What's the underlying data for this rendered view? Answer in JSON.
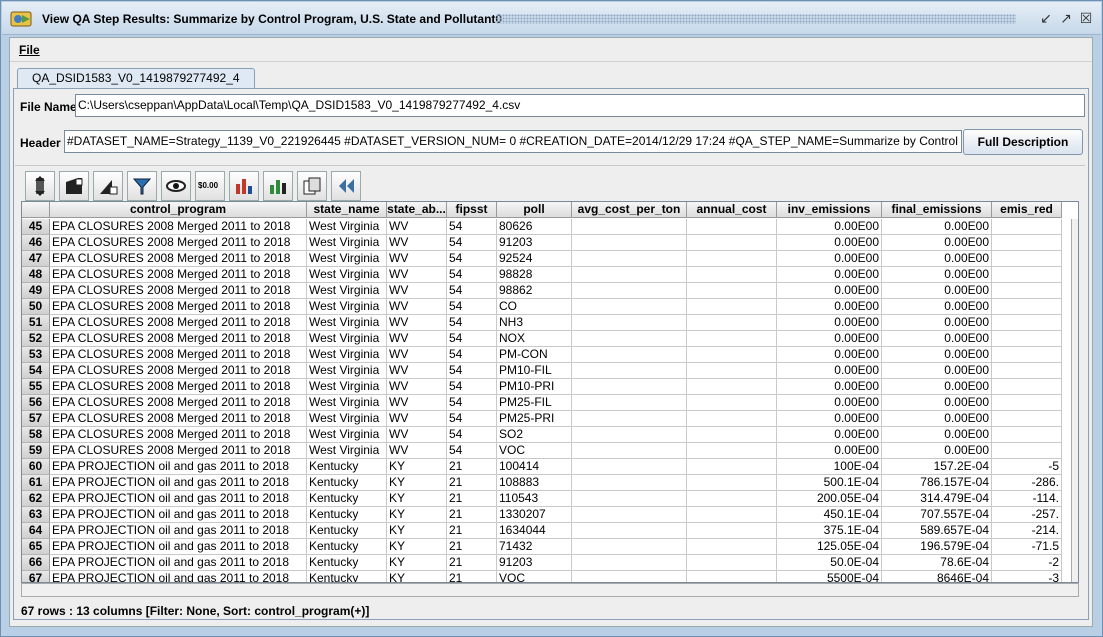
{
  "window": {
    "title": "View QA Step Results: Summarize by Control Program, U.S. State and Pollutant0",
    "minimize_glyph": "↙",
    "maximize_glyph": "↗",
    "close_glyph": "☒"
  },
  "menu": {
    "file_label": "File"
  },
  "tab": {
    "label": "QA_DSID1583_V0_1419879277492_4"
  },
  "file": {
    "label": "File Name",
    "value": "C:\\Users\\cseppan\\AppData\\Local\\Temp\\QA_DSID1583_V0_1419879277492_4.csv"
  },
  "header_field": {
    "label": "Header",
    "value": "#DATASET_NAME=Strategy_1139_V0_221926445 #DATASET_VERSION_NUM= 0 #CREATION_DATE=2014/12/29 17:24 #QA_STEP_NAME=Summarize by Control",
    "button_label": "Full Description"
  },
  "toolbar": {
    "icons": [
      "sort-icon",
      "format-icon",
      "chart-icon",
      "filter-icon",
      "view-icon",
      "money-icon",
      "bar-chart-icon",
      "bar-chart-alt-icon",
      "copy-icon",
      "rewind-icon"
    ],
    "money_text": "$0.00"
  },
  "table": {
    "columns": [
      "control_program",
      "state_name",
      "state_ab...",
      "fipsst",
      "poll",
      "avg_cost_per_ton",
      "annual_cost",
      "inv_emissions",
      "final_emissions",
      "emis_red"
    ],
    "rows": [
      {
        "n": "45",
        "c": [
          "EPA CLOSURES 2008 Merged 2011 to 2018",
          "West Virginia",
          "WV",
          "54",
          "80626",
          "",
          "",
          "0.00E00",
          "0.00E00",
          ""
        ]
      },
      {
        "n": "46",
        "c": [
          "EPA CLOSURES 2008 Merged 2011 to 2018",
          "West Virginia",
          "WV",
          "54",
          "91203",
          "",
          "",
          "0.00E00",
          "0.00E00",
          ""
        ]
      },
      {
        "n": "47",
        "c": [
          "EPA CLOSURES 2008 Merged 2011 to 2018",
          "West Virginia",
          "WV",
          "54",
          "92524",
          "",
          "",
          "0.00E00",
          "0.00E00",
          ""
        ]
      },
      {
        "n": "48",
        "c": [
          "EPA CLOSURES 2008 Merged 2011 to 2018",
          "West Virginia",
          "WV",
          "54",
          "98828",
          "",
          "",
          "0.00E00",
          "0.00E00",
          ""
        ]
      },
      {
        "n": "49",
        "c": [
          "EPA CLOSURES 2008 Merged 2011 to 2018",
          "West Virginia",
          "WV",
          "54",
          "98862",
          "",
          "",
          "0.00E00",
          "0.00E00",
          ""
        ]
      },
      {
        "n": "50",
        "c": [
          "EPA CLOSURES 2008 Merged 2011 to 2018",
          "West Virginia",
          "WV",
          "54",
          "CO",
          "",
          "",
          "0.00E00",
          "0.00E00",
          ""
        ]
      },
      {
        "n": "51",
        "c": [
          "EPA CLOSURES 2008 Merged 2011 to 2018",
          "West Virginia",
          "WV",
          "54",
          "NH3",
          "",
          "",
          "0.00E00",
          "0.00E00",
          ""
        ]
      },
      {
        "n": "52",
        "c": [
          "EPA CLOSURES 2008 Merged 2011 to 2018",
          "West Virginia",
          "WV",
          "54",
          "NOX",
          "",
          "",
          "0.00E00",
          "0.00E00",
          ""
        ]
      },
      {
        "n": "53",
        "c": [
          "EPA CLOSURES 2008 Merged 2011 to 2018",
          "West Virginia",
          "WV",
          "54",
          "PM-CON",
          "",
          "",
          "0.00E00",
          "0.00E00",
          ""
        ]
      },
      {
        "n": "54",
        "c": [
          "EPA CLOSURES 2008 Merged 2011 to 2018",
          "West Virginia",
          "WV",
          "54",
          "PM10-FIL",
          "",
          "",
          "0.00E00",
          "0.00E00",
          ""
        ]
      },
      {
        "n": "55",
        "c": [
          "EPA CLOSURES 2008 Merged 2011 to 2018",
          "West Virginia",
          "WV",
          "54",
          "PM10-PRI",
          "",
          "",
          "0.00E00",
          "0.00E00",
          ""
        ]
      },
      {
        "n": "56",
        "c": [
          "EPA CLOSURES 2008 Merged 2011 to 2018",
          "West Virginia",
          "WV",
          "54",
          "PM25-FIL",
          "",
          "",
          "0.00E00",
          "0.00E00",
          ""
        ]
      },
      {
        "n": "57",
        "c": [
          "EPA CLOSURES 2008 Merged 2011 to 2018",
          "West Virginia",
          "WV",
          "54",
          "PM25-PRI",
          "",
          "",
          "0.00E00",
          "0.00E00",
          ""
        ]
      },
      {
        "n": "58",
        "c": [
          "EPA CLOSURES 2008 Merged 2011 to 2018",
          "West Virginia",
          "WV",
          "54",
          "SO2",
          "",
          "",
          "0.00E00",
          "0.00E00",
          ""
        ]
      },
      {
        "n": "59",
        "c": [
          "EPA CLOSURES 2008 Merged 2011 to 2018",
          "West Virginia",
          "WV",
          "54",
          "VOC",
          "",
          "",
          "0.00E00",
          "0.00E00",
          ""
        ]
      },
      {
        "n": "60",
        "c": [
          "EPA PROJECTION oil and gas 2011 to 2018",
          "Kentucky",
          "KY",
          "21",
          "100414",
          "",
          "",
          "100E-04",
          "157.2E-04",
          "-5"
        ]
      },
      {
        "n": "61",
        "c": [
          "EPA PROJECTION oil and gas 2011 to 2018",
          "Kentucky",
          "KY",
          "21",
          "108883",
          "",
          "",
          "500.1E-04",
          "786.157E-04",
          "-286."
        ]
      },
      {
        "n": "62",
        "c": [
          "EPA PROJECTION oil and gas 2011 to 2018",
          "Kentucky",
          "KY",
          "21",
          "110543",
          "",
          "",
          "200.05E-04",
          "314.479E-04",
          "-114."
        ]
      },
      {
        "n": "63",
        "c": [
          "EPA PROJECTION oil and gas 2011 to 2018",
          "Kentucky",
          "KY",
          "21",
          "1330207",
          "",
          "",
          "450.1E-04",
          "707.557E-04",
          "-257."
        ]
      },
      {
        "n": "64",
        "c": [
          "EPA PROJECTION oil and gas 2011 to 2018",
          "Kentucky",
          "KY",
          "21",
          "1634044",
          "",
          "",
          "375.1E-04",
          "589.657E-04",
          "-214."
        ]
      },
      {
        "n": "65",
        "c": [
          "EPA PROJECTION oil and gas 2011 to 2018",
          "Kentucky",
          "KY",
          "21",
          "71432",
          "",
          "",
          "125.05E-04",
          "196.579E-04",
          "-71.5"
        ]
      },
      {
        "n": "66",
        "c": [
          "EPA PROJECTION oil and gas 2011 to 2018",
          "Kentucky",
          "KY",
          "21",
          "91203",
          "",
          "",
          "50.0E-04",
          "78.6E-04",
          "-2"
        ]
      },
      {
        "n": "67",
        "c": [
          "EPA PROJECTION oil and gas 2011 to 2018",
          "Kentucky",
          "KY",
          "21",
          "VOC",
          "",
          "",
          "5500E-04",
          "8646E-04",
          "-3"
        ]
      }
    ]
  },
  "status": {
    "text": "67 rows : 13 columns [Filter: None, Sort: control_program(+)]"
  },
  "colors": {
    "title_bar": "#c6d8ea",
    "window_frame": "#b8cfe5",
    "panel": "#eeeeee",
    "chart_red": "#c0392b",
    "chart_green": "#2e8b3a"
  }
}
